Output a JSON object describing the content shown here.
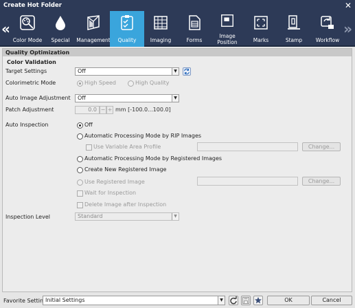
{
  "window": {
    "title": "Create Hot Folder"
  },
  "toolbar": {
    "tabs": [
      {
        "label": "Color Mode",
        "icon": "color-mode-icon"
      },
      {
        "label": "Special",
        "icon": "drop-icon"
      },
      {
        "label": "Management",
        "icon": "cube-icon"
      },
      {
        "label": "Quality",
        "icon": "quality-icon",
        "active": true
      },
      {
        "label": "Imaging",
        "icon": "imaging-icon"
      },
      {
        "label": "Forms",
        "icon": "forms-icon"
      },
      {
        "label": "Image\nPosition",
        "icon": "image-position-icon"
      },
      {
        "label": "Marks",
        "icon": "marks-icon"
      },
      {
        "label": "Stamp",
        "icon": "stamp-icon"
      },
      {
        "label": "Workflow",
        "icon": "workflow-icon"
      }
    ]
  },
  "section": {
    "title": "Quality Optimization",
    "color_validation": {
      "title": "Color Validation",
      "target_label": "Target Settings",
      "target_value": "Off",
      "colorimetric_label": "Colorimetric Mode",
      "high_speed": "High Speed",
      "high_quality": "High Quality"
    },
    "auto_image_label": "Auto Image Adjustment",
    "auto_image_value": "Off",
    "patch_label": "Patch Adjustment",
    "patch_value": "0.0",
    "patch_minus": "−",
    "patch_plus": "+",
    "patch_range": "mm [-100.0...100.0]",
    "auto_inspection": {
      "label": "Auto Inspection",
      "off": "Off",
      "by_rip": "Automatic Processing Mode by RIP Images",
      "variable_area": "Use Variable Area Profile",
      "change1": "Change...",
      "by_registered": "Automatic Processing Mode by Registered Images",
      "create_new": "Create New Registered Image",
      "use_registered": "Use Registered Image",
      "change2": "Change...",
      "wait": "Wait for Inspection",
      "delete_after": "Delete Image after Inspection"
    },
    "inspection_level_label": "Inspection Level",
    "inspection_level_value": "Standard"
  },
  "footer": {
    "favorite_label": "Favorite Setting",
    "favorite_value": "Initial Settings",
    "ok": "OK",
    "cancel": "Cancel"
  },
  "colors": {
    "header": "#2d3a57",
    "active_tab": "#3aa5dc"
  }
}
